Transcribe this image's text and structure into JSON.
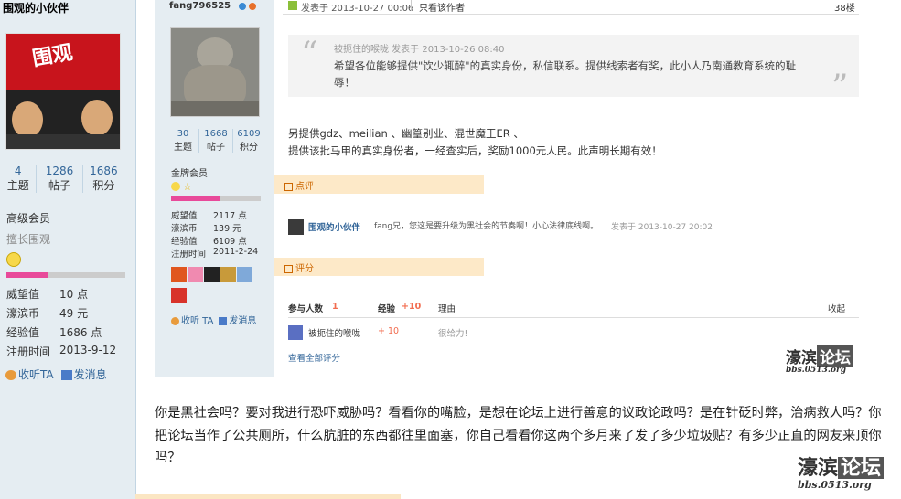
{
  "left_panel": {
    "username": "围观的小伙伴",
    "avatar_text": "围观",
    "stats": [
      {
        "num": "4",
        "label": "主题"
      },
      {
        "num": "1286",
        "label": "帖子"
      },
      {
        "num": "1686",
        "label": "积分"
      }
    ],
    "level": "高级会员",
    "sublevel": "擅长围观",
    "progress": 0.35,
    "details": [
      {
        "k": "威望值",
        "v": "10 点"
      },
      {
        "k": "濠滨币",
        "v": "49 元"
      },
      {
        "k": "经验值",
        "v": "1686 点"
      },
      {
        "k": "注册时间",
        "v": "2013-9-12"
      }
    ],
    "collect_label": "收听TA",
    "message_label": "发消息"
  },
  "embedded": {
    "username": "fang796525",
    "stats": [
      {
        "num": "30",
        "label": "主题"
      },
      {
        "num": "1668",
        "label": "帖子"
      },
      {
        "num": "6109",
        "label": "积分"
      }
    ],
    "level": "金牌会员",
    "progress": 0.55,
    "details": [
      {
        "k": "威望值",
        "v": "2117 点"
      },
      {
        "k": "濠滨币",
        "v": "139 元"
      },
      {
        "k": "经验值",
        "v": "6109 点"
      },
      {
        "k": "注册时间",
        "v": "2011-2-24"
      }
    ],
    "collect_label": "收听 TA",
    "message_label": "发消息",
    "post_time": "发表于 2013-10-27 00:06",
    "only_author": "只看该作者",
    "floor": "38楼",
    "quote_header": "被扼住的喉咙 发表于 2013-10-26 08:40",
    "quote_text": "希望各位能够提供\"饮少辄醉\"的真实身份，私信联系。提供线索者有奖，此小人乃南通教育系统的耻辱！",
    "body_line1": "另提供gdz、meilian 、幽篁别业、混世魔王ER 、",
    "body_line2": "提供该批马甲的真实身份者，一经查实后，奖励1000元人民。此声明长期有效！",
    "comment_tab": "点评",
    "comment_user": "围观的小伙伴",
    "comment_text": "fang兄，您这是要升级为黑社会的节奏啊！小心法律底线啊。",
    "comment_time": "发表于 2013-10-27 20:02",
    "rate_tab": "评分",
    "rate_headers": {
      "participants": "参与人数",
      "participants_count": "1",
      "exp": "经验",
      "exp_val": "+10",
      "reason": "理由",
      "collapse": "收起"
    },
    "rate_row": {
      "user": "被扼住的喉咙",
      "exp": "+ 10",
      "reason": "很给力!"
    },
    "view_all": "查看全部评分",
    "watermark_a": "濠滨",
    "watermark_b": "论坛",
    "watermark_url": "bbs.0513.org"
  },
  "reply_text": "你是黑社会吗？要对我进行恐吓威胁吗？看看你的嘴脸，是想在论坛上进行善意的议政论政吗？是在针砭时弊，治病救人吗？你把论坛当作了公共厕所，什么肮脏的东西都往里面塞，你自己看看你这两个多月来了发了多少垃圾贴？有多少正直的网友来顶你吗？",
  "watermark": {
    "a": "濠滨",
    "b": "论坛",
    "url": "bbs.0513.org"
  }
}
